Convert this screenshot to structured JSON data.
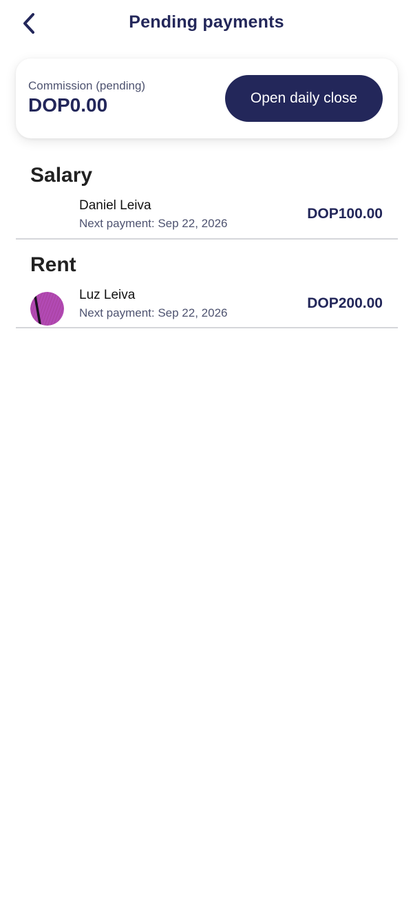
{
  "header": {
    "title": "Pending payments",
    "back_icon": "chevron-left-icon"
  },
  "commission": {
    "label": "Commission (pending)",
    "amount": "DOP0.00",
    "button_label": "Open daily close"
  },
  "sections": [
    {
      "title": "Salary",
      "items": [
        {
          "name": "Daniel Leiva",
          "next_payment": "Next payment: Sep 22, 2026",
          "amount": "DOP100.00",
          "avatar": "none"
        }
      ]
    },
    {
      "title": "Rent",
      "items": [
        {
          "name": "Luz Leiva",
          "next_payment": "Next payment: Sep 22, 2026",
          "amount": "DOP200.00",
          "avatar": "purple-photo"
        }
      ]
    }
  ],
  "colors": {
    "primary": "#23275a",
    "divider": "#d5d6da",
    "avatar_purple": "#b24ab4"
  }
}
